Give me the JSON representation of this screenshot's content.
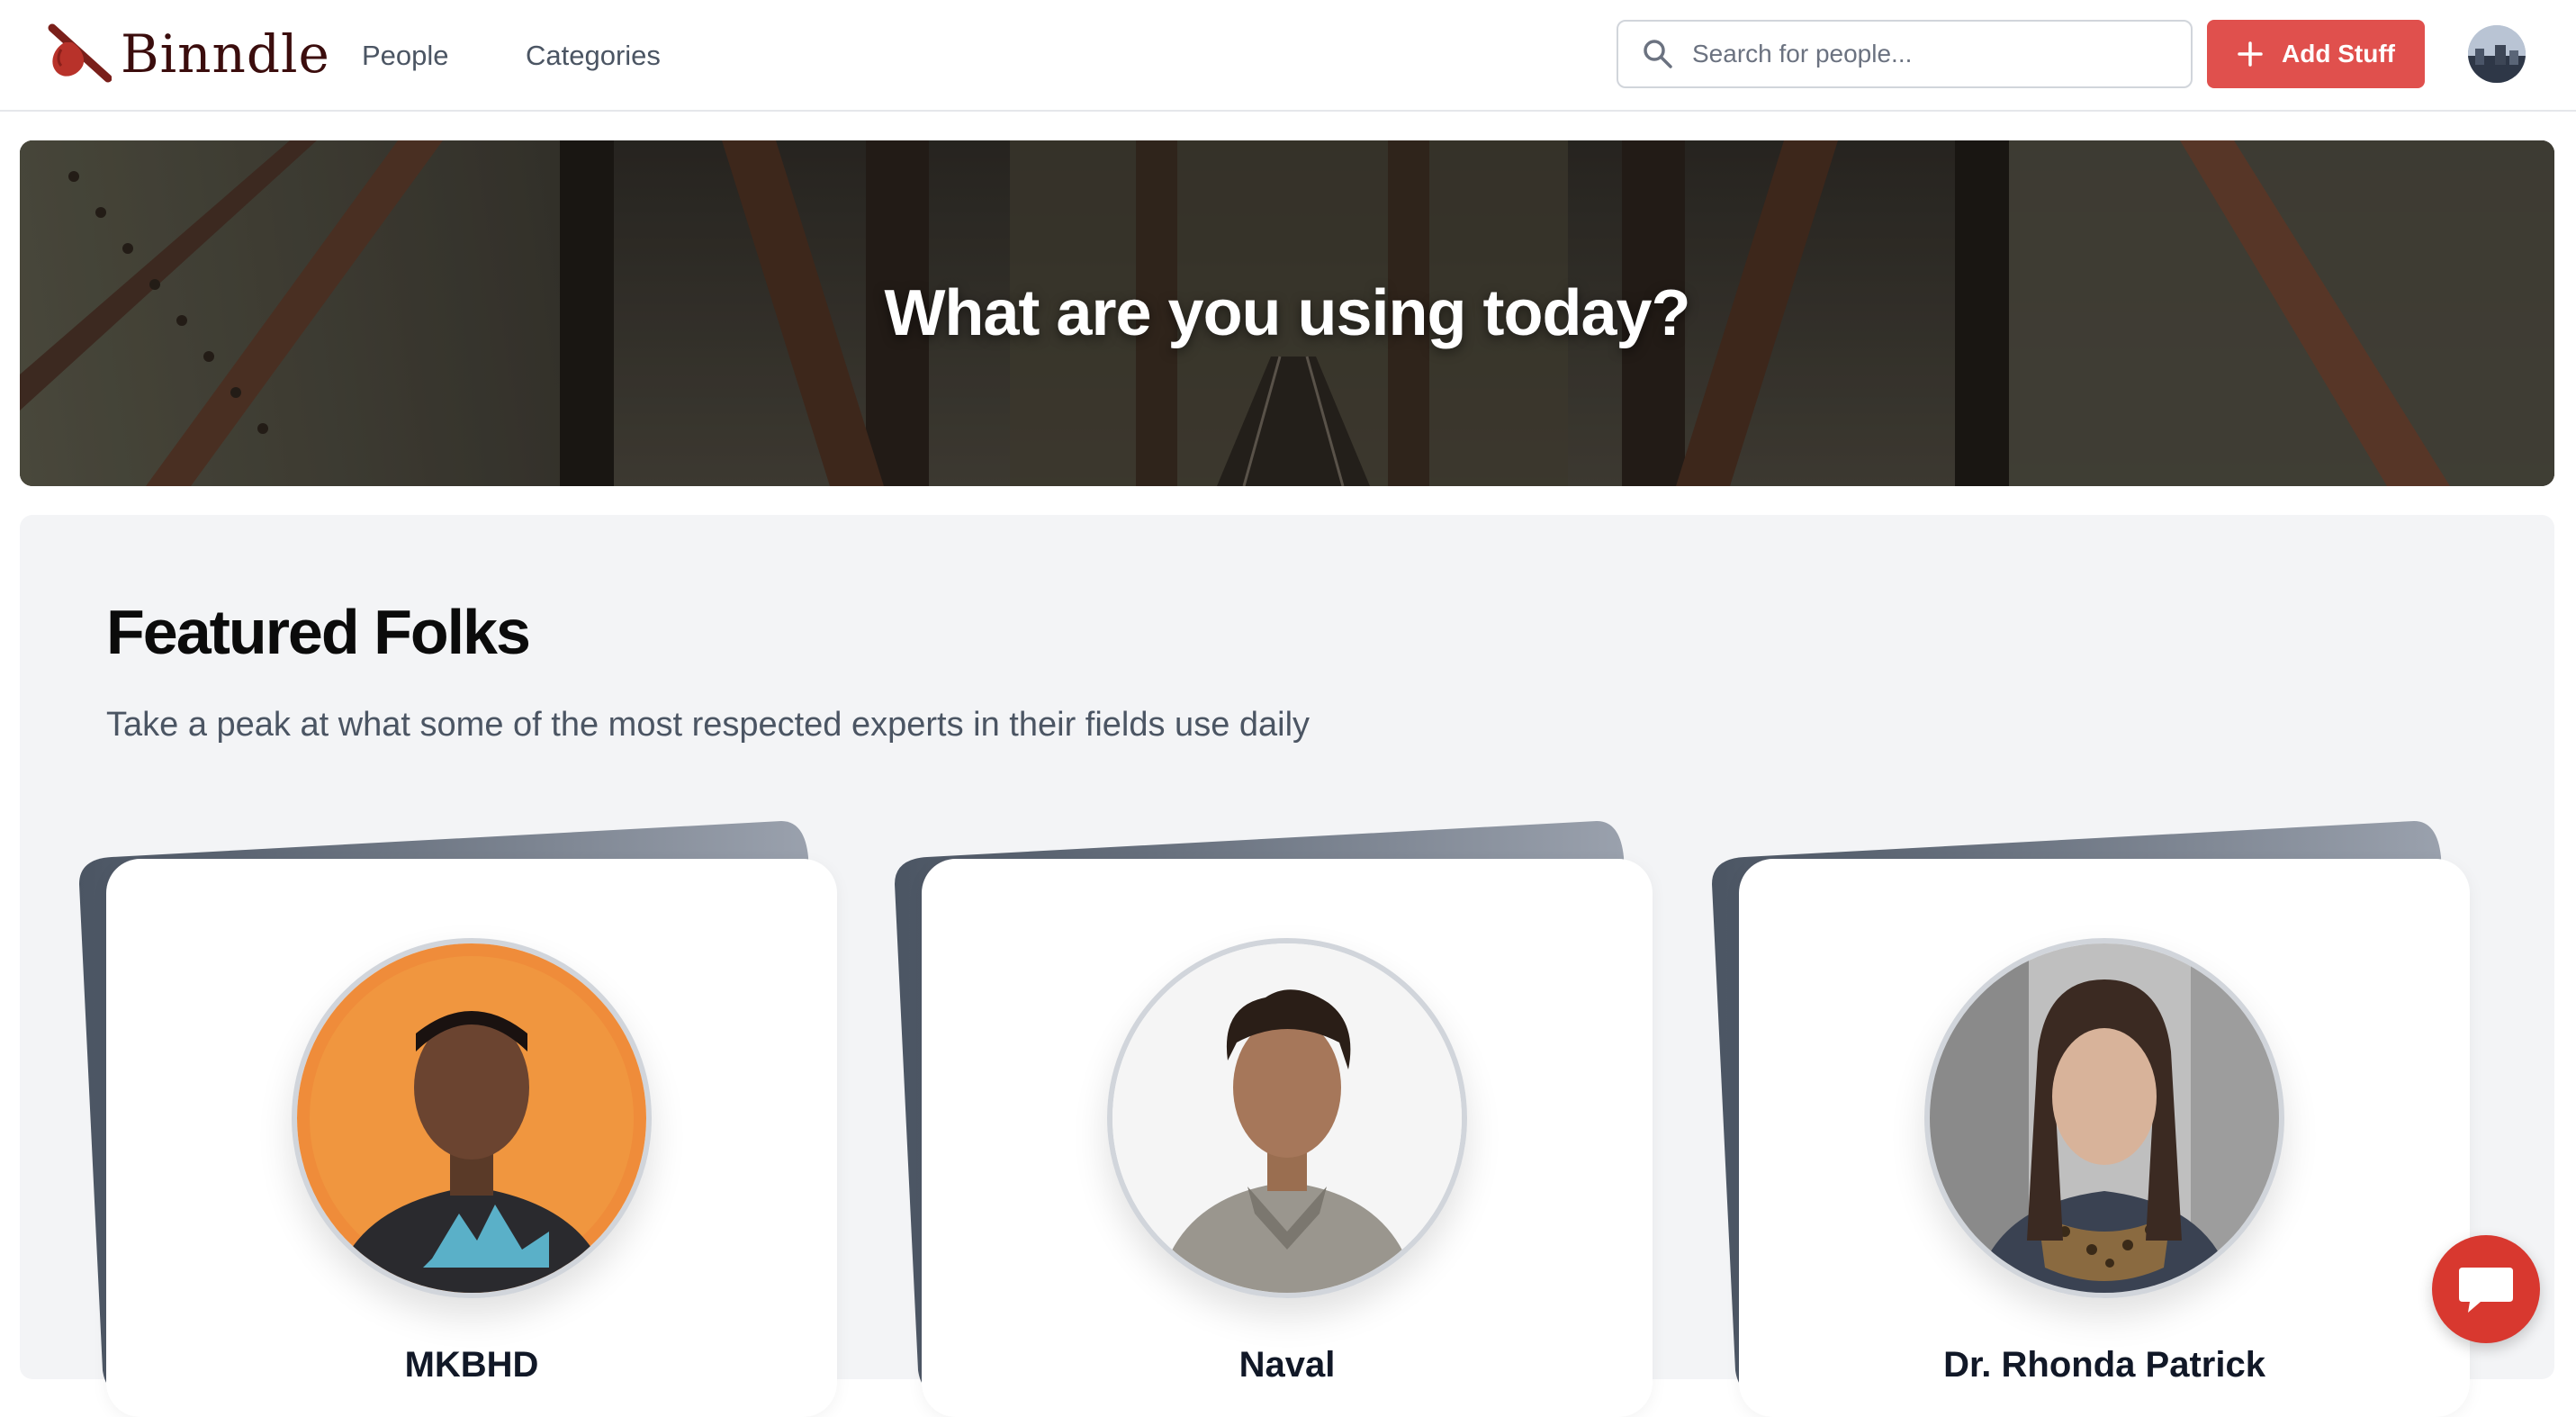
{
  "header": {
    "logo_text": "Binndle",
    "logo_icon": "bindle-stick-icon",
    "nav": [
      {
        "label": "People"
      },
      {
        "label": "Categories"
      }
    ],
    "search": {
      "placeholder": "Search for people...",
      "value": ""
    },
    "add_button_label": "Add Stuff",
    "accent_color": "#e0504d"
  },
  "hero": {
    "title": "What are you using today?"
  },
  "featured": {
    "title": "Featured Folks",
    "subtitle": "Take a peak at what some of the most respected experts in their fields use daily",
    "people": [
      {
        "name": "MKBHD"
      },
      {
        "name": "Naval"
      },
      {
        "name": "Dr. Rhonda Patrick"
      }
    ]
  },
  "chat": {
    "icon": "chat-bubble-icon",
    "color": "#d8382f"
  }
}
